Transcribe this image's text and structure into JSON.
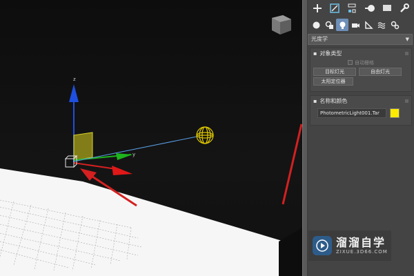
{
  "viewport": {
    "axis_labels": {
      "z": "z",
      "y": "y"
    },
    "colors": {
      "background": "#121212",
      "plane": "#f5f5f5",
      "grid": "#bdbdbd",
      "arrow": "#e02020",
      "z_axis": "#1f4fe0",
      "y_axis": "#1db41d",
      "x_axis": "#d42020",
      "light_bulb": "#e0c800",
      "target_line": "#5aa0e8"
    }
  },
  "command_panel": {
    "tabs": [
      {
        "name": "create",
        "icon": "plus-icon"
      },
      {
        "name": "modify",
        "icon": "modify-icon"
      },
      {
        "name": "hierarchy",
        "icon": "hierarchy-icon"
      },
      {
        "name": "motion",
        "icon": "motion-icon"
      },
      {
        "name": "display",
        "icon": "display-icon"
      },
      {
        "name": "utilities",
        "icon": "wrench-icon"
      }
    ],
    "subtabs": [
      {
        "name": "geometry",
        "icon": "sphere-icon"
      },
      {
        "name": "shapes",
        "icon": "shapes-icon"
      },
      {
        "name": "lights",
        "icon": "light-icon",
        "active": true
      },
      {
        "name": "cameras",
        "icon": "camera-icon"
      },
      {
        "name": "helpers",
        "icon": "ruler-icon"
      },
      {
        "name": "space-warps",
        "icon": "waves-icon"
      },
      {
        "name": "systems",
        "icon": "gears-icon"
      }
    ],
    "category_dropdown": "光度学",
    "object_type": {
      "title": "对象类型",
      "auto_grid": "自动栅格",
      "buttons": [
        "目标灯光",
        "自由灯光",
        "太阳定位器"
      ]
    },
    "name_color": {
      "title": "名称和颜色",
      "name_value": "PhotometricLight001.Tar",
      "color": "#ffeb00"
    }
  },
  "watermark": {
    "title": "溜溜自学",
    "subtitle": "ZIXUE.3D66.COM"
  }
}
